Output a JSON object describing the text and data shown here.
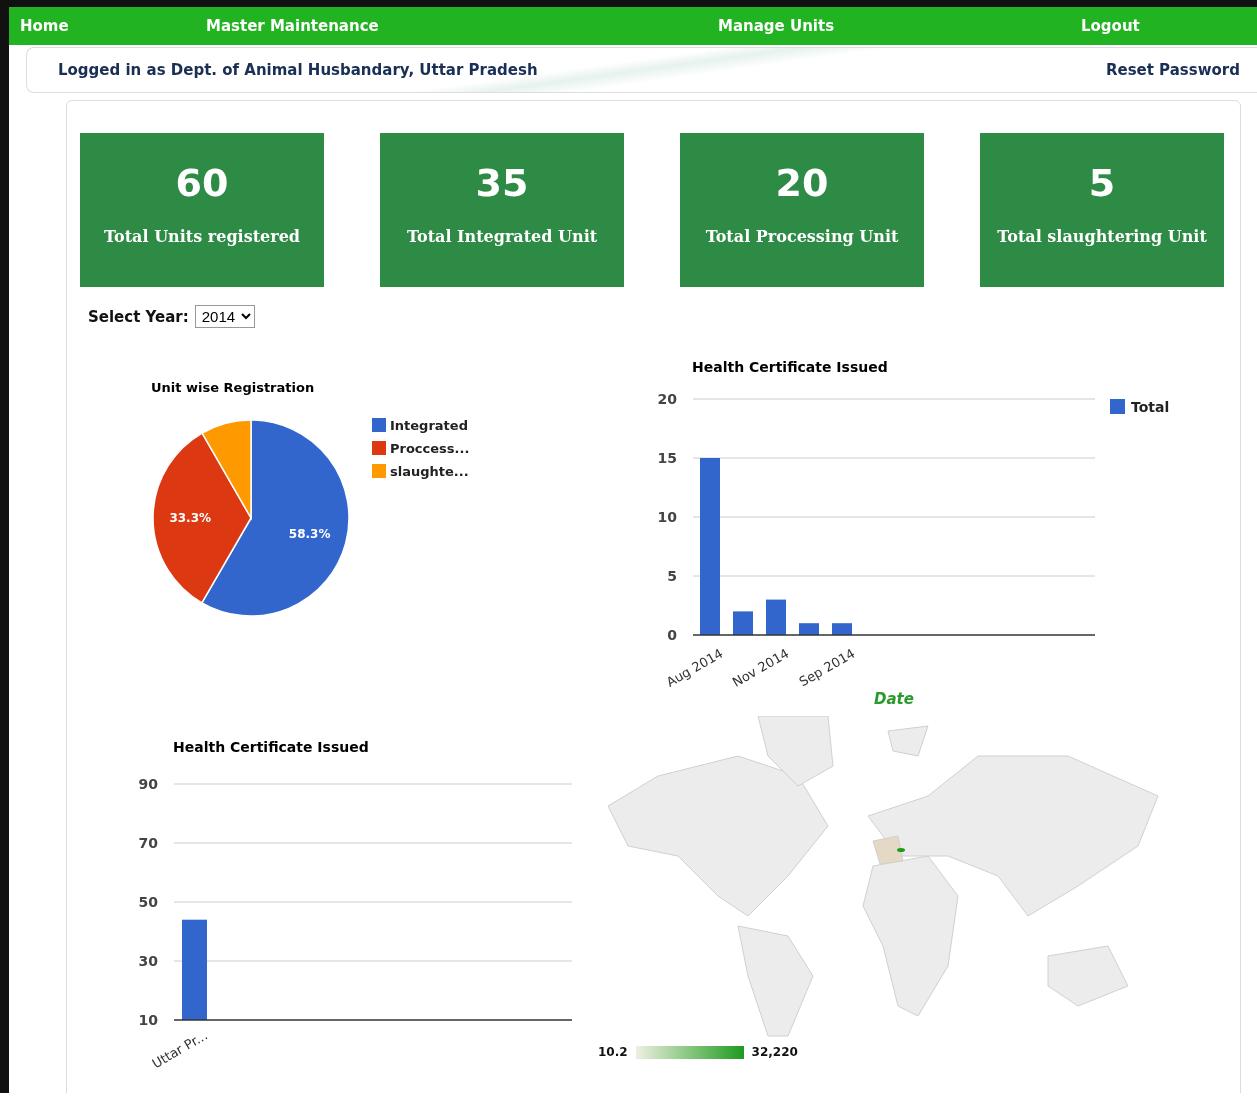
{
  "nav": {
    "items": [
      {
        "label": "Home"
      },
      {
        "label": "Master Maintenance"
      },
      {
        "label": "Manage Units"
      },
      {
        "label": "Logout"
      }
    ]
  },
  "subheader": {
    "logged_in": "Logged in as Dept. of Animal Husbandary, Uttar Pradesh",
    "reset_link": "Reset Password"
  },
  "stats": [
    {
      "value": "60",
      "label": "Total Units registered"
    },
    {
      "value": "35",
      "label": "Total Integrated Unit"
    },
    {
      "value": "20",
      "label": "Total Processing Unit"
    },
    {
      "value": "5",
      "label": "Total slaughtering Unit"
    }
  ],
  "year_select": {
    "label": "Select Year:",
    "value": "2014"
  },
  "pie_chart": {
    "chart_data": {
      "type": "pie",
      "title": "Unit wise Registration",
      "categories": [
        "Integrated",
        "Proccess...",
        "slaughte..."
      ],
      "values": [
        58.3,
        33.3,
        8.3
      ],
      "value_labels": [
        "58.3%",
        "33.3%",
        null
      ],
      "legend": true
    }
  },
  "date_chart": {
    "chart_data": {
      "type": "bar",
      "title": "Health Certificate Issued",
      "xlabel": "Date",
      "categories": [
        "Aug 2014",
        null,
        "Nov 2014",
        null,
        "Sep 2014"
      ],
      "series": [
        {
          "name": "Total",
          "color": "#3366cc",
          "values": [
            15,
            2,
            3,
            1,
            1
          ]
        }
      ],
      "ylim": [
        0,
        20
      ],
      "yticks": [
        {
          "value": 0,
          "label": "0"
        },
        {
          "value": 5,
          "label": "5"
        },
        {
          "value": 10,
          "label": "10"
        },
        {
          "value": 15,
          "label": "15"
        },
        {
          "value": 20,
          "label": "20"
        }
      ],
      "grid": true,
      "legend": true
    }
  },
  "state_chart": {
    "chart_data": {
      "type": "bar",
      "title": "Health Certificate Issued",
      "categories": [
        "Uttar Pr..."
      ],
      "series": [
        {
          "color": "#3366cc",
          "values": [
            44
          ]
        }
      ],
      "ylim": [
        10,
        90
      ],
      "yticks": [
        10,
        30,
        50,
        70,
        90
      ],
      "grid": true
    }
  },
  "map": {
    "kind": "picture",
    "legend_min": "10.2",
    "legend_max": "32,220"
  }
}
